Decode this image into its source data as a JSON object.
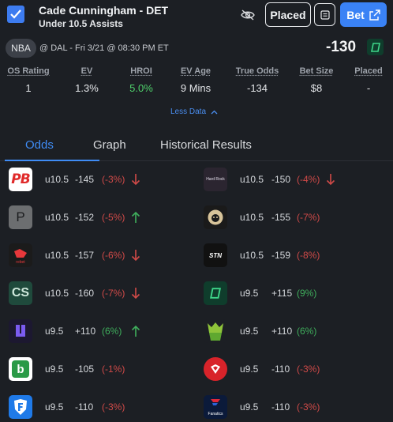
{
  "header": {
    "title": "Cade Cunningham - DET",
    "subtitle": "Under 10.5 Assists",
    "placed_label": "Placed",
    "bet_label": "Bet"
  },
  "game": {
    "league": "NBA",
    "info": "@ DAL - Fri 3/21 @ 08:30 PM ET",
    "best_odds": "-130",
    "best_book_icon": "fliff-logo"
  },
  "stats": [
    {
      "label": "OS Rating",
      "value": "1"
    },
    {
      "label": "EV",
      "value": "1.3%"
    },
    {
      "label": "HROI",
      "value": "5.0%"
    },
    {
      "label": "EV Age",
      "value": "9 Mins"
    },
    {
      "label": "True Odds",
      "value": "-134"
    },
    {
      "label": "Bet Size",
      "value": "$8"
    },
    {
      "label": "Placed",
      "value": "-"
    }
  ],
  "less_data_label": "Less Data",
  "tabs": [
    {
      "label": "Odds",
      "active": true
    },
    {
      "label": "Graph",
      "active": false
    },
    {
      "label": "Historical Results",
      "active": false
    }
  ],
  "odds": [
    {
      "book": "pointsbet-logo",
      "line": "u10.5",
      "price": "-145",
      "ev": "(-3%)",
      "trend": "down"
    },
    {
      "book": "hardrock-logo",
      "line": "u10.5",
      "price": "-150",
      "ev": "(-4%)",
      "trend": "down"
    },
    {
      "book": "prophetx-logo",
      "line": "u10.5",
      "price": "-152",
      "ev": "(-5%)",
      "trend": "up"
    },
    {
      "book": "betrivers-logo",
      "line": "u10.5",
      "price": "-155",
      "ev": "(-7%)",
      "trend": "none"
    },
    {
      "book": "rebet-logo",
      "line": "u10.5",
      "price": "-157",
      "ev": "(-6%)",
      "trend": "down"
    },
    {
      "book": "stn-logo",
      "line": "u10.5",
      "price": "-159",
      "ev": "(-8%)",
      "trend": "none"
    },
    {
      "book": "caesars-logo",
      "line": "u10.5",
      "price": "-160",
      "ev": "(-7%)",
      "trend": "down"
    },
    {
      "book": "fliff-logo",
      "line": "u9.5",
      "price": "+115",
      "ev": "(9%)",
      "trend": "none"
    },
    {
      "book": "underdog-logo",
      "line": "u9.5",
      "price": "+110",
      "ev": "(6%)",
      "trend": "up"
    },
    {
      "book": "draftkings-logo",
      "line": "u9.5",
      "price": "+110",
      "ev": "(6%)",
      "trend": "none"
    },
    {
      "book": "betonline-logo",
      "line": "u9.5",
      "price": "-105",
      "ev": "(-1%)",
      "trend": "none"
    },
    {
      "book": "espnbet-logo",
      "line": "u9.5",
      "price": "-110",
      "ev": "(-3%)",
      "trend": "none"
    },
    {
      "book": "fanduel-logo",
      "line": "u9.5",
      "price": "-110",
      "ev": "(-3%)",
      "trend": "none"
    },
    {
      "book": "fanatics-logo",
      "line": "u9.5",
      "price": "-110",
      "ev": "(-3%)",
      "trend": "none"
    }
  ],
  "logo_text": {
    "pb": "PB",
    "p": "P",
    "cs": "CS",
    "b": "b",
    "stn": "STN",
    "rebet": "rebet",
    "hardrock": "Hard Rock",
    "fanatics": "Fanatics"
  },
  "colors": {
    "accent": "#3a82f5",
    "negative": "#d04a48",
    "positive": "#3fae5c",
    "background": "#1c1f24"
  }
}
